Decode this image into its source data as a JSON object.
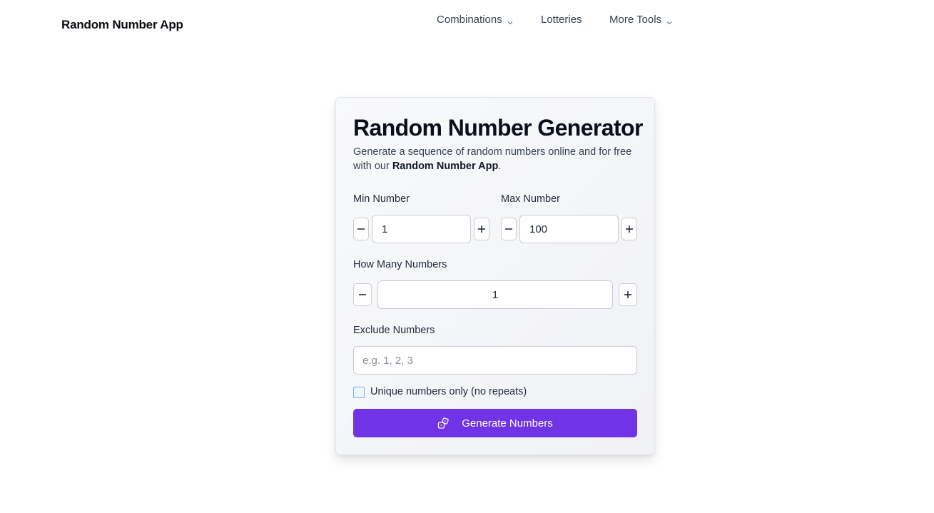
{
  "header": {
    "brand": "Random Number App",
    "nav": [
      {
        "label": "Combinations",
        "has_dropdown": true
      },
      {
        "label": "Lotteries",
        "has_dropdown": false
      },
      {
        "label": "More Tools",
        "has_dropdown": true
      }
    ]
  },
  "card": {
    "title": "Random Number Generator",
    "description_prefix": "Generate a sequence of random numbers online and for free with our ",
    "description_bold": "Random Number App",
    "description_suffix": ".",
    "min": {
      "label": "Min Number",
      "value": "1"
    },
    "max": {
      "label": "Max Number",
      "value": "100"
    },
    "count": {
      "label": "How Many Numbers",
      "value": "1"
    },
    "exclude": {
      "label": "Exclude Numbers",
      "placeholder": "e.g. 1, 2, 3",
      "value": ""
    },
    "unique": {
      "label": "Unique numbers only (no repeats)",
      "checked": false
    },
    "generate_label": "Generate Numbers"
  },
  "colors": {
    "accent": "#7034e6",
    "text": "#111827",
    "border": "#c9ccd3"
  }
}
